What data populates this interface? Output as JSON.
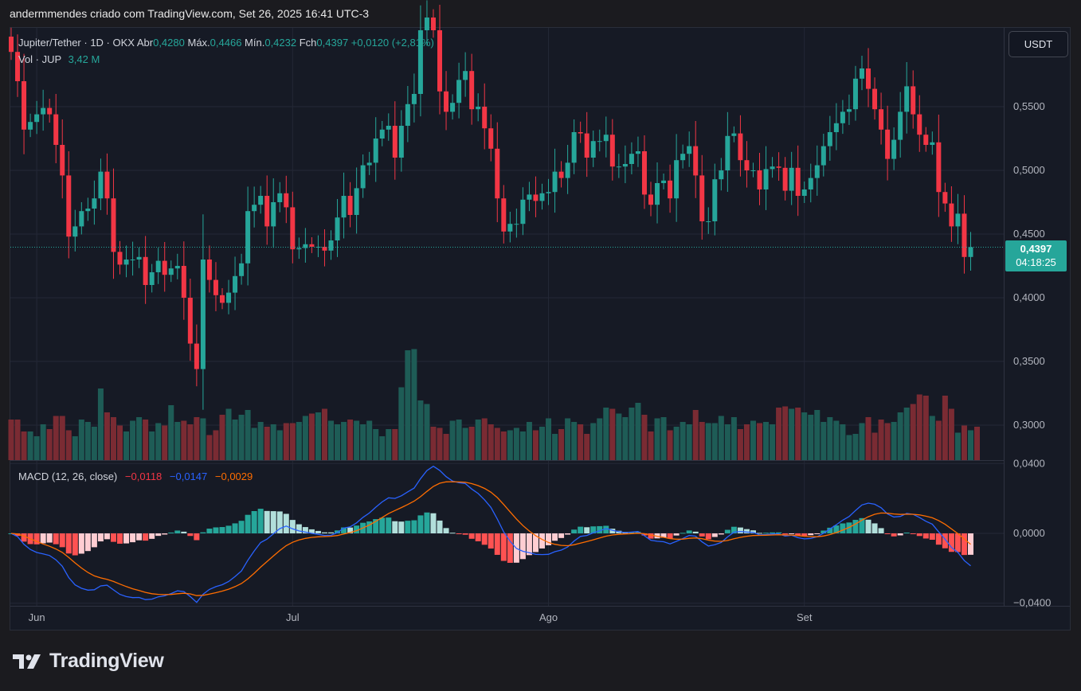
{
  "header": {
    "caption": "andermmendes criado com TradingView.com, Set 26, 2025 16:41 UTC-3"
  },
  "legend": {
    "symbol": "Jupiter/Tether · 1D · OKX",
    "open_label": "Abr",
    "open": "0,4280",
    "high_label": "Máx.",
    "high": "0,4466",
    "low_label": "Mín.",
    "low": "0,4232",
    "close_label": "Fch",
    "close": "0,4397",
    "change": "+0,0120 (+2,81%)",
    "vol_label": "Vol · JUP",
    "vol": "3,42 M"
  },
  "macd_legend": {
    "label": "MACD (12, 26, close)",
    "hist": "−0,0118",
    "macd": "−0,0147",
    "signal": "−0,0029"
  },
  "currency_button": "USDT",
  "price_tag": {
    "price": "0,4397",
    "countdown": "04:18:25"
  },
  "brand": {
    "name": "TradingView",
    "icon": "tradingview-logo-icon"
  },
  "colors": {
    "up": "#26a69a",
    "down": "#f23645",
    "macd": "#2962ff",
    "signal": "#ff6d00"
  },
  "chart_data": {
    "type": "candlestick",
    "x_labels": [
      "Jun",
      "Jul",
      "Ago",
      "Set"
    ],
    "price_ticks": [
      "0,5500",
      "0,5000",
      "0,4500",
      "0,4000",
      "0,3500",
      "0,3000"
    ],
    "macd_ticks": [
      "0,0400",
      "0,0000",
      "−0,0400"
    ],
    "price_range": [
      0.2725,
      0.6125
    ],
    "macd_range": [
      -0.0415,
      0.0415
    ],
    "close": [
      0.593,
      0.57,
      0.532,
      0.538,
      0.544,
      0.549,
      0.544,
      0.52,
      0.496,
      0.448,
      0.456,
      0.468,
      0.47,
      0.478,
      0.499,
      0.478,
      0.436,
      0.426,
      0.43,
      0.43,
      0.432,
      0.41,
      0.42,
      0.429,
      0.418,
      0.423,
      0.425,
      0.4,
      0.364,
      0.344,
      0.43,
      0.414,
      0.402,
      0.396,
      0.404,
      0.417,
      0.427,
      0.468,
      0.473,
      0.48,
      0.456,
      0.475,
      0.482,
      0.471,
      0.438,
      0.439,
      0.442,
      0.44,
      0.44,
      0.437,
      0.445,
      0.463,
      0.48,
      0.465,
      0.486,
      0.504,
      0.506,
      0.525,
      0.532,
      0.535,
      0.51,
      0.535,
      0.552,
      0.56,
      0.61,
      0.62,
      0.61,
      0.562,
      0.546,
      0.553,
      0.571,
      0.578,
      0.548,
      0.55,
      0.533,
      0.517,
      0.478,
      0.452,
      0.458,
      0.458,
      0.477,
      0.481,
      0.476,
      0.482,
      0.483,
      0.499,
      0.494,
      0.506,
      0.53,
      0.529,
      0.51,
      0.523,
      0.523,
      0.528,
      0.503,
      0.503,
      0.505,
      0.513,
      0.515,
      0.481,
      0.473,
      0.49,
      0.492,
      0.478,
      0.508,
      0.513,
      0.519,
      0.496,
      0.46,
      0.46,
      0.493,
      0.5,
      0.527,
      0.529,
      0.508,
      0.5,
      0.5,
      0.485,
      0.501,
      0.503,
      0.502,
      0.484,
      0.502,
      0.48,
      0.485,
      0.494,
      0.504,
      0.519,
      0.53,
      0.537,
      0.546,
      0.548,
      0.572,
      0.58,
      0.564,
      0.548,
      0.532,
      0.509,
      0.524,
      0.546,
      0.566,
      0.544,
      0.528,
      0.52,
      0.522,
      0.483,
      0.474,
      0.456,
      0.466,
      0.432,
      0.4397
    ],
    "volume_ratio": [
      0.34,
      0.34,
      0.24,
      0.24,
      0.2,
      0.3,
      0.26,
      0.37,
      0.37,
      0.25,
      0.2,
      0.34,
      0.32,
      0.28,
      0.6,
      0.4,
      0.36,
      0.29,
      0.24,
      0.33,
      0.36,
      0.34,
      0.24,
      0.31,
      0.29,
      0.46,
      0.32,
      0.33,
      0.3,
      0.36,
      0.35,
      0.21,
      0.25,
      0.38,
      0.43,
      0.34,
      0.38,
      0.42,
      0.27,
      0.32,
      0.28,
      0.3,
      0.25,
      0.31,
      0.31,
      0.32,
      0.37,
      0.39,
      0.4,
      0.43,
      0.33,
      0.3,
      0.32,
      0.34,
      0.33,
      0.3,
      0.33,
      0.26,
      0.2,
      0.26,
      0.26,
      0.61,
      0.92,
      0.93,
      0.5,
      0.47,
      0.28,
      0.27,
      0.22,
      0.33,
      0.34,
      0.27,
      0.28,
      0.34,
      0.35,
      0.3,
      0.27,
      0.24,
      0.25,
      0.27,
      0.24,
      0.32,
      0.25,
      0.28,
      0.35,
      0.22,
      0.26,
      0.35,
      0.32,
      0.3,
      0.22,
      0.31,
      0.35,
      0.44,
      0.43,
      0.39,
      0.36,
      0.44,
      0.48,
      0.38,
      0.24,
      0.35,
      0.36,
      0.25,
      0.28,
      0.32,
      0.3,
      0.42,
      0.32,
      0.31,
      0.31,
      0.37,
      0.3,
      0.36,
      0.26,
      0.3,
      0.33,
      0.31,
      0.32,
      0.3,
      0.44,
      0.45,
      0.43,
      0.44,
      0.4,
      0.38,
      0.42,
      0.32,
      0.36,
      0.33,
      0.3,
      0.21,
      0.22,
      0.31,
      0.36,
      0.23,
      0.34,
      0.31,
      0.32,
      0.4,
      0.44,
      0.47,
      0.55,
      0.54,
      0.37,
      0.33,
      0.54,
      0.43,
      0.23,
      0.29,
      0.25,
      0.28
    ]
  }
}
